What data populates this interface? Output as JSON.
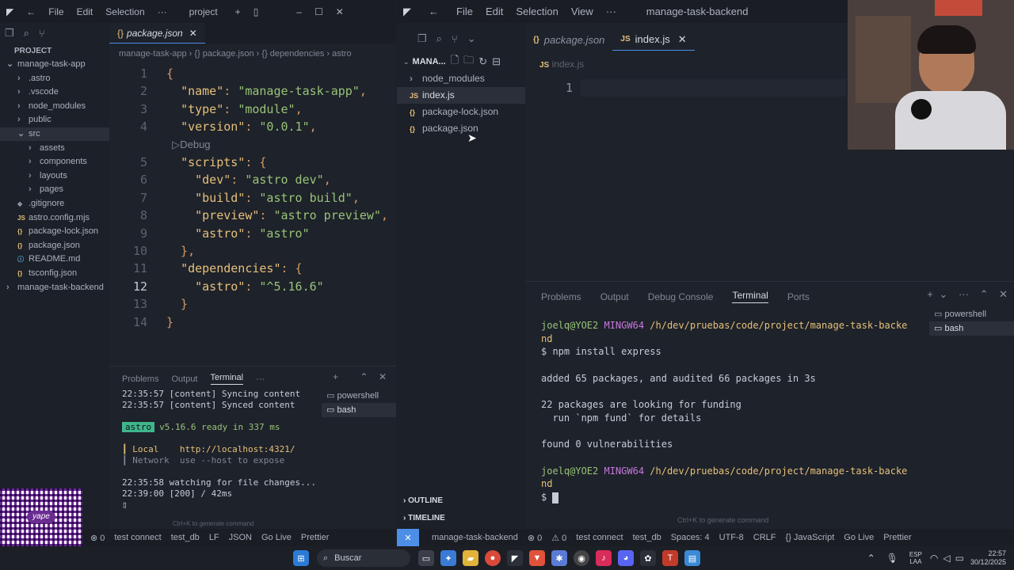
{
  "left_window": {
    "menu": [
      "File",
      "Edit",
      "Selection",
      "···"
    ],
    "title": "project",
    "sidebar_title": "PROJECT",
    "tree": [
      {
        "label": "manage-task-app",
        "indent": 0,
        "kind": "folder",
        "open": true
      },
      {
        "label": ".astro",
        "indent": 1,
        "kind": "folder"
      },
      {
        "label": ".vscode",
        "indent": 1,
        "kind": "folder"
      },
      {
        "label": "node_modules",
        "indent": 1,
        "kind": "folder"
      },
      {
        "label": "public",
        "indent": 1,
        "kind": "folder"
      },
      {
        "label": "src",
        "indent": 1,
        "kind": "folder",
        "open": true,
        "selected": true
      },
      {
        "label": "assets",
        "indent": 2,
        "kind": "folder"
      },
      {
        "label": "components",
        "indent": 2,
        "kind": "folder"
      },
      {
        "label": "layouts",
        "indent": 2,
        "kind": "folder"
      },
      {
        "label": "pages",
        "indent": 2,
        "kind": "folder"
      },
      {
        "label": ".gitignore",
        "indent": 1,
        "kind": "file",
        "icon": "◆"
      },
      {
        "label": "astro.config.mjs",
        "indent": 1,
        "kind": "file",
        "icon": "JS"
      },
      {
        "label": "package-lock.json",
        "indent": 1,
        "kind": "file",
        "icon": "{}"
      },
      {
        "label": "package.json",
        "indent": 1,
        "kind": "file",
        "icon": "{}"
      },
      {
        "label": "README.md",
        "indent": 1,
        "kind": "file",
        "icon": "ⓘ"
      },
      {
        "label": "tsconfig.json",
        "indent": 1,
        "kind": "file",
        "icon": "{}"
      },
      {
        "label": "manage-task-backend",
        "indent": 0,
        "kind": "folder"
      }
    ],
    "tab": "package.json",
    "breadcrumb": [
      "manage-task-app",
      "{} package.json",
      "{} dependencies",
      "astro"
    ],
    "code": [
      {
        "n": "1",
        "t": "{"
      },
      {
        "n": "2",
        "t": "  \"name\": \"manage-task-app\","
      },
      {
        "n": "3",
        "t": "  \"type\": \"module\","
      },
      {
        "n": "4",
        "t": "  \"version\": \"0.0.1\","
      },
      {
        "n": "",
        "t": "  ▷Debug"
      },
      {
        "n": "5",
        "t": "  \"scripts\": {"
      },
      {
        "n": "6",
        "t": "    \"dev\": \"astro dev\","
      },
      {
        "n": "7",
        "t": "    \"build\": \"astro build\","
      },
      {
        "n": "8",
        "t": "    \"preview\": \"astro preview\","
      },
      {
        "n": "9",
        "t": "    \"astro\": \"astro\""
      },
      {
        "n": "10",
        "t": "  },"
      },
      {
        "n": "11",
        "t": "  \"dependencies\": {"
      },
      {
        "n": "12",
        "t": "    \"astro\": \"^5.16.6\""
      },
      {
        "n": "13",
        "t": "  }"
      },
      {
        "n": "14",
        "t": "}"
      }
    ],
    "panel_tabs": [
      "Problems",
      "Output",
      "Terminal",
      "···"
    ],
    "terminal_sessions": [
      "powershell",
      "bash"
    ],
    "terminal": [
      "22:35:57 [content] Syncing content",
      "22:35:57 [content] Synced content",
      "",
      "astro  v5.16.6 ready in 337 ms",
      "",
      "┃ Local    http://localhost:4321/",
      "┃ Network  use --host to expose",
      "",
      "22:35:58 watching for file changes...",
      "22:39:00 [200] / 42ms",
      "▯"
    ],
    "hint": "Ctrl+K to generate command",
    "status": [
      "⊗ 0",
      "test connect",
      "test_db",
      "LF",
      "JSON",
      "Go Live",
      "Prettier"
    ]
  },
  "right_window": {
    "menu": [
      "File",
      "Edit",
      "Selection",
      "View",
      "···"
    ],
    "title": "manage-task-backend",
    "sidebar_title": "MANA...",
    "tree": [
      {
        "label": "node_modules",
        "kind": "folder"
      },
      {
        "label": "index.js",
        "kind": "file",
        "icon": "JS",
        "selected": true
      },
      {
        "label": "package-lock.json",
        "kind": "file",
        "icon": "{}"
      },
      {
        "label": "package.json",
        "kind": "file",
        "icon": "{}"
      }
    ],
    "tabs": [
      {
        "label": "package.json",
        "active": false
      },
      {
        "label": "index.js",
        "active": true
      }
    ],
    "breadcrumb": "index.js",
    "line_number": "1",
    "panel_tabs": [
      "Problems",
      "Output",
      "Debug Console",
      "Terminal",
      "Ports"
    ],
    "terminal_sessions": [
      "powershell",
      "bash"
    ],
    "terminal": [
      "joelq@YOE2 MINGW64 /h/dev/pruebas/code/project/manage-task-backe",
      "nd",
      "$ npm install express",
      "",
      "added 65 packages, and audited 66 packages in 3s",
      "",
      "22 packages are looking for funding",
      "  run `npm fund` for details",
      "",
      "found 0 vulnerabilities",
      "",
      "joelq@YOE2 MINGW64 /h/dev/pruebas/code/project/manage-task-backe",
      "nd",
      "$ "
    ],
    "hint": "Ctrl+K to generate command",
    "outline": "OUTLINE",
    "timeline": "TIMELINE",
    "status": [
      "manage-task-backend",
      "⊗ 0",
      "⚠ 0",
      "test connect",
      "test_db",
      "Spaces: 4",
      "UTF-8",
      "CRLF",
      "{} JavaScript",
      "Go Live",
      "Prettier"
    ]
  },
  "taskbar": {
    "search": "Buscar",
    "lang": "ESP",
    "lang2": "LAA",
    "time": "22:57",
    "date": "30/12/2025"
  },
  "qr_label": "yape",
  "colors": {
    "accent": "#4d8fe6",
    "astro_badge": "#3fb68b"
  }
}
